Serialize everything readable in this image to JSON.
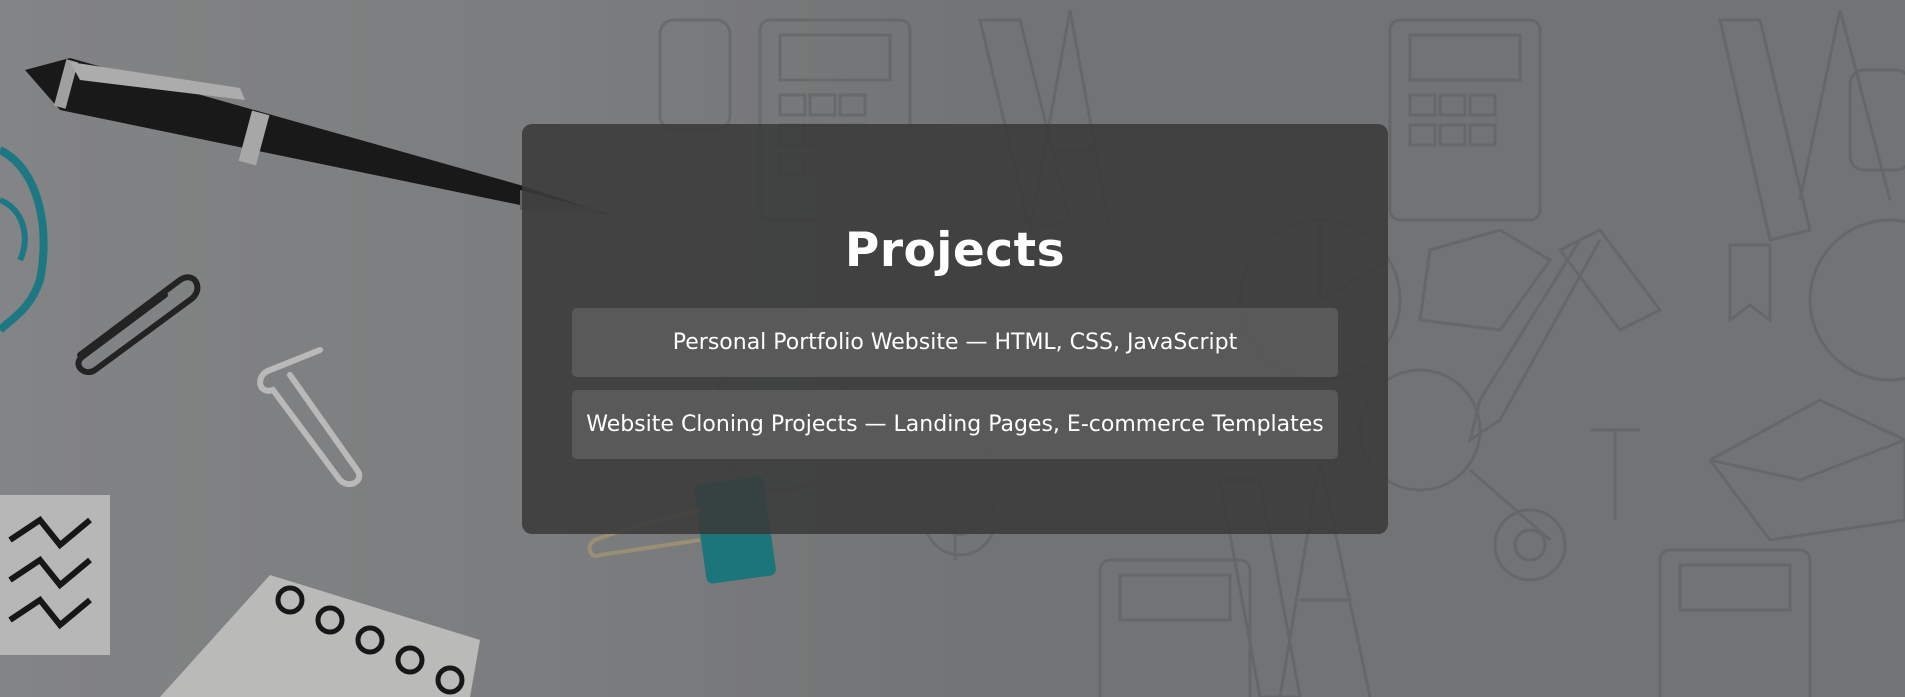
{
  "section": {
    "title": "Projects"
  },
  "projects": [
    {
      "label": "Personal Portfolio Website — HTML, CSS, JavaScript"
    },
    {
      "label": "Website Cloning Projects — Landing Pages, E-commerce Templates"
    }
  ],
  "colors": {
    "panel_background": "#3a3a3a",
    "item_background": "#6e6e6e",
    "text": "#ffffff",
    "page_background": "#8f9193"
  }
}
